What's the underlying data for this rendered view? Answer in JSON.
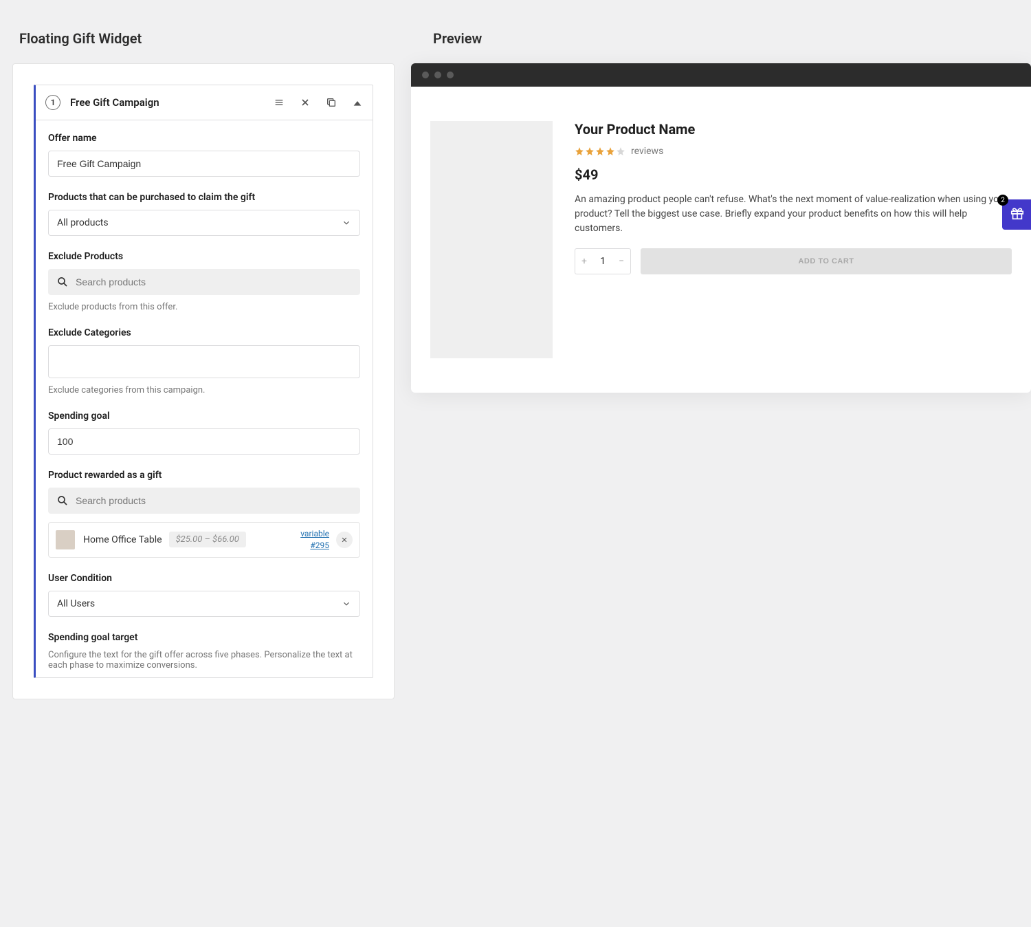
{
  "left": {
    "title": "Floating Gift Widget",
    "campaign": {
      "number": "1",
      "title": "Free Gift Campaign"
    },
    "offer_name": {
      "label": "Offer name",
      "value": "Free Gift Campaign"
    },
    "products_claim": {
      "label": "Products that can be purchased to claim the gift",
      "value": "All products"
    },
    "exclude_products": {
      "label": "Exclude Products",
      "placeholder": "Search products",
      "help": "Exclude products from this offer."
    },
    "exclude_categories": {
      "label": "Exclude Categories",
      "help": "Exclude categories from this campaign."
    },
    "spending_goal": {
      "label": "Spending goal",
      "value": "100"
    },
    "product_rewarded": {
      "label": "Product rewarded as a gift",
      "placeholder": "Search products",
      "item": {
        "name": "Home Office Table",
        "price": "$25.00 – $66.00",
        "type": "variable",
        "id": "#295"
      }
    },
    "user_condition": {
      "label": "User Condition",
      "value": "All Users"
    },
    "spending_target": {
      "label": "Spending goal target",
      "help": "Configure the text for the gift offer across five phases. Personalize the text at each phase to maximize conversions."
    }
  },
  "preview": {
    "title": "Preview",
    "product_name": "Your Product Name",
    "reviews": "reviews",
    "price": "$49",
    "desc": "An amazing product people can't refuse. What's the next moment of value-realization when using your product? Tell the biggest use case. Briefly expand your product benefits on how this will help customers.",
    "qty": "1",
    "addcart": "ADD TO CART",
    "badge": "2"
  }
}
